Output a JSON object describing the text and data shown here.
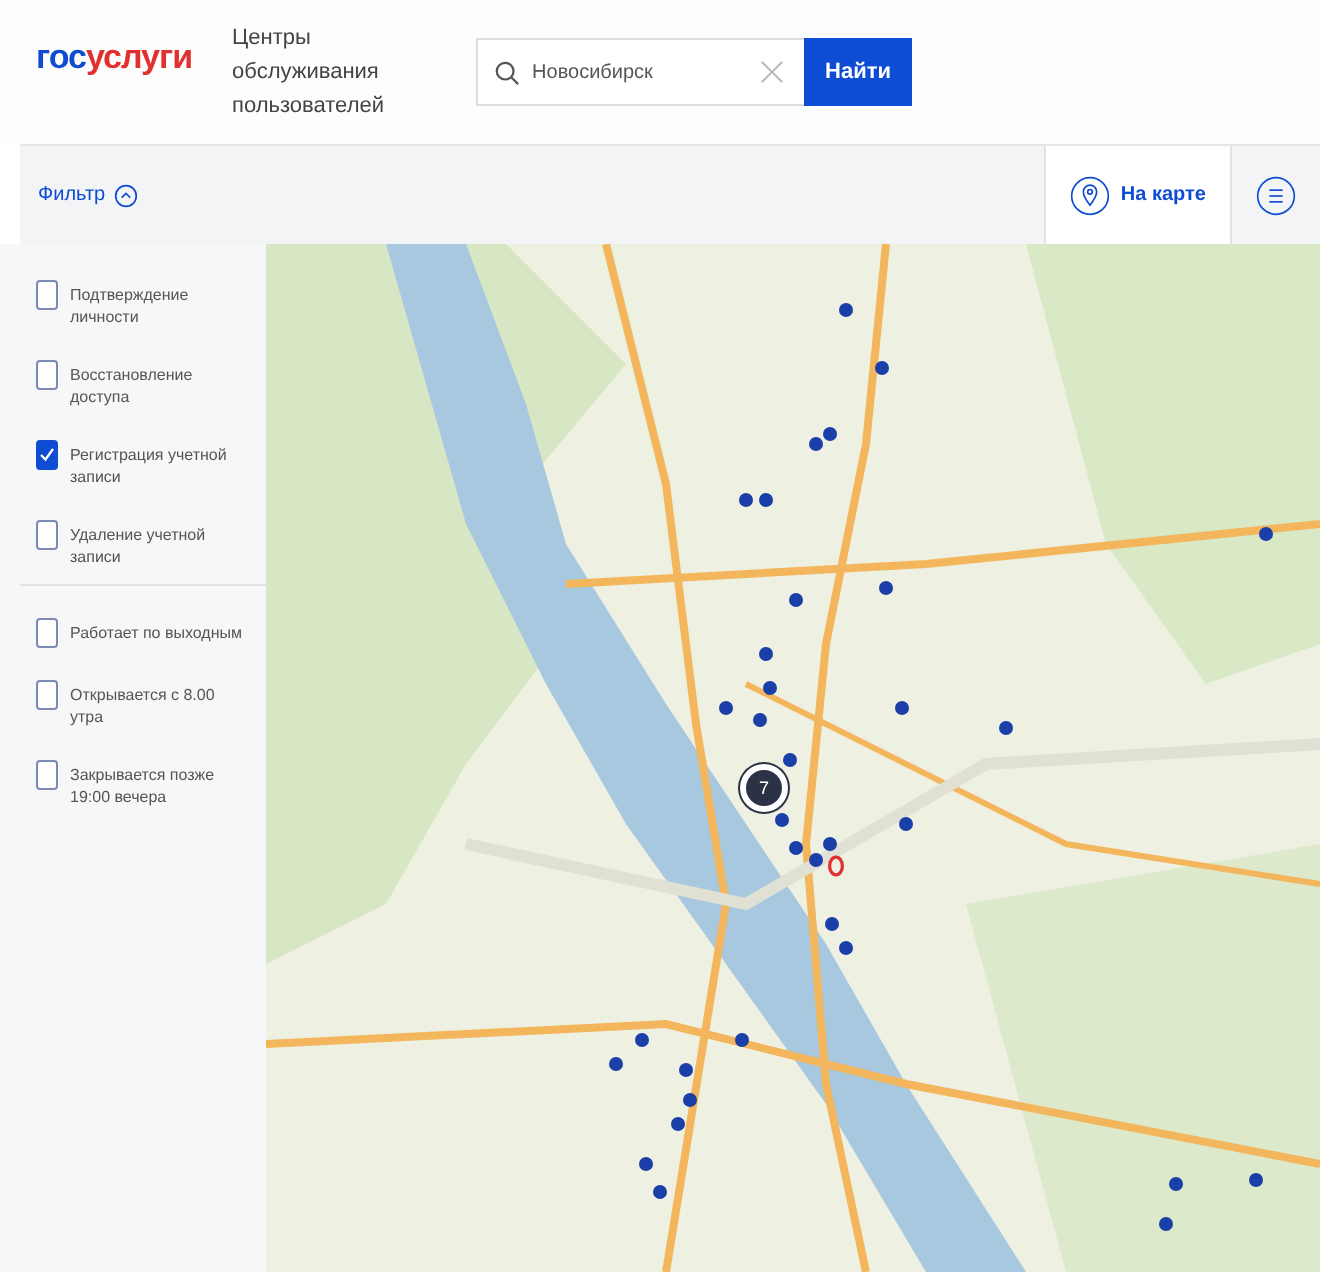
{
  "header": {
    "logo_left": "гос",
    "logo_right": "услуги",
    "title": "Центры обслуживания пользователей",
    "search": {
      "value": "Новосибирск",
      "button": "Найти"
    }
  },
  "toolbar": {
    "filter_label": "Фильтр",
    "filter_expanded": true,
    "view_tabs": [
      {
        "label": "На карте",
        "kind": "map",
        "selected": true
      },
      {
        "kind": "list",
        "selected": false
      }
    ]
  },
  "filters": [
    {
      "items": [
        {
          "label": "Подтверждение личности",
          "checked": false
        },
        {
          "label": "Восстановление доступа",
          "checked": false
        },
        {
          "label": "Регистрация учетной записи",
          "checked": true
        },
        {
          "label": "Удаление учетной записи",
          "checked": false
        }
      ]
    },
    {
      "items": [
        {
          "label": "Работает по выходным",
          "checked": false
        },
        {
          "label": "Открывается с 8.00 утра",
          "checked": false
        },
        {
          "label": "Закрывается позже 19:00 вечера",
          "checked": false
        }
      ]
    }
  ],
  "map": {
    "kind": "picture",
    "cluster": {
      "count": "7"
    }
  }
}
